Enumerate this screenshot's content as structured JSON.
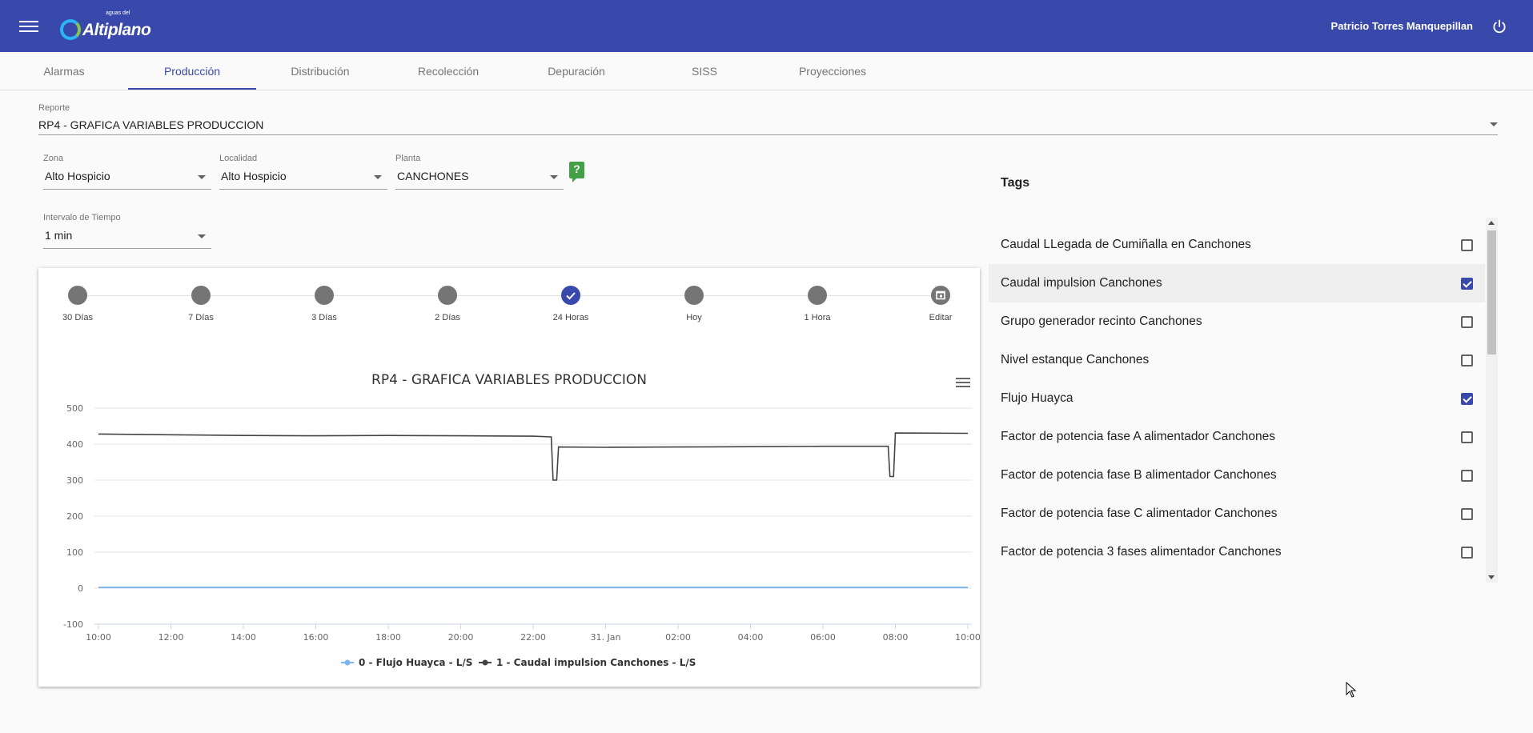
{
  "header": {
    "logo_text": "Altiplano",
    "logo_small": "aguas del",
    "user_name": "Patricio Torres Manquepillan",
    "icons": {
      "menu": "menu-icon",
      "power": "power-icon"
    }
  },
  "tabs": [
    {
      "label": "Alarmas"
    },
    {
      "label": "Producción",
      "active": true
    },
    {
      "label": "Distribución"
    },
    {
      "label": "Recolección"
    },
    {
      "label": "Depuración"
    },
    {
      "label": "SISS"
    },
    {
      "label": "Proyecciones"
    }
  ],
  "report": {
    "label": "Reporte",
    "value": "RP4 - GRAFICA VARIABLES PRODUCCION"
  },
  "filters": {
    "zona": {
      "label": "Zona",
      "value": "Alto Hospicio"
    },
    "localidad": {
      "label": "Localidad",
      "value": "Alto Hospicio"
    },
    "planta": {
      "label": "Planta",
      "value": "CANCHONES"
    },
    "intervalo": {
      "label": "Intervalo de Tiempo",
      "value": "1 min"
    },
    "help": "?"
  },
  "steps": [
    {
      "label": "30 Días"
    },
    {
      "label": "7 Días"
    },
    {
      "label": "3 Días"
    },
    {
      "label": "2 Días"
    },
    {
      "label": "24 Horas",
      "active": true
    },
    {
      "label": "Hoy"
    },
    {
      "label": "1 Hora"
    },
    {
      "label": "Editar"
    }
  ],
  "chart_data": {
    "type": "line",
    "title": "RP4 - GRAFICA VARIABLES PRODUCCION",
    "xlabel": "",
    "ylabel": "",
    "ylim": [
      -100,
      500
    ],
    "y_ticks": [
      "500",
      "400",
      "300",
      "200",
      "100",
      "0",
      "-100"
    ],
    "x_ticks": [
      "10:00",
      "12:00",
      "14:00",
      "16:00",
      "18:00",
      "20:00",
      "22:00",
      "31. Jan",
      "02:00",
      "04:00",
      "06:00",
      "08:00",
      "10:00"
    ],
    "x_range_hours": [
      10,
      34
    ],
    "grid": true,
    "legend_position": "bottom",
    "series": [
      {
        "name": "0 - Flujo Huayca - L/S",
        "color": "#7cb5ec",
        "x": [
          10,
          34
        ],
        "values": [
          2,
          2
        ]
      },
      {
        "name": "1 - Caudal impulsion Canchones - L/S",
        "color": "#434348",
        "x": [
          10,
          12,
          14,
          16,
          18,
          20,
          22,
          22.5,
          22.55,
          22.65,
          22.7,
          24,
          26,
          28,
          30,
          31.8,
          31.85,
          31.95,
          32.0,
          34
        ],
        "values": [
          428,
          426,
          424,
          423,
          424,
          423,
          422,
          420,
          300,
          300,
          392,
          391,
          392,
          393,
          394,
          394,
          310,
          310,
          431,
          430
        ]
      }
    ]
  },
  "tags": {
    "title": "Tags",
    "items": [
      {
        "label": "Caudal LLegada de Cumiñalla en Canchones",
        "checked": false
      },
      {
        "label": "Caudal impulsion Canchones",
        "checked": true,
        "highlight": true
      },
      {
        "label": "Grupo generador recinto Canchones",
        "checked": false
      },
      {
        "label": "Nivel estanque Canchones",
        "checked": false
      },
      {
        "label": "Flujo Huayca",
        "checked": true
      },
      {
        "label": "Factor de potencia fase A alimentador Canchones",
        "checked": false
      },
      {
        "label": "Factor de potencia fase B alimentador Canchones",
        "checked": false
      },
      {
        "label": "Factor de potencia fase C alimentador Canchones",
        "checked": false
      },
      {
        "label": "Factor de potencia 3 fases alimentador Canchones",
        "checked": false
      }
    ]
  },
  "colors": {
    "primary": "#3949ab",
    "help": "#43a047"
  }
}
